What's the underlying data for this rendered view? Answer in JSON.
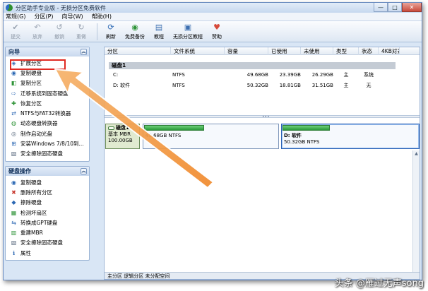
{
  "window": {
    "title": "分区助手专业版 - 无损分区免费软件",
    "controls": [
      "—",
      "□",
      "✕"
    ]
  },
  "menu": [
    "常规(G)",
    "分区(P)",
    "向导(W)",
    "帮助(H)"
  ],
  "toolbar": [
    {
      "label": "提交",
      "icon": "check-icon",
      "glyph": "✔",
      "enabled": false
    },
    {
      "label": "放弃",
      "icon": "discard-icon",
      "glyph": "↶",
      "enabled": false
    },
    {
      "label": "撤销",
      "icon": "undo-icon",
      "glyph": "↺",
      "enabled": false
    },
    {
      "label": "重做",
      "icon": "redo-icon",
      "glyph": "↻",
      "enabled": false
    },
    {
      "label": "刷新",
      "icon": "refresh-icon",
      "glyph": "⟳",
      "enabled": true
    },
    {
      "label": "免费备份",
      "icon": "backup-icon",
      "glyph": "◉",
      "enabled": true
    },
    {
      "label": "教程",
      "icon": "tutorial-icon",
      "glyph": "▤",
      "enabled": true
    },
    {
      "label": "无损分区教程",
      "icon": "partition-tutorial-icon",
      "glyph": "▣",
      "enabled": true
    },
    {
      "label": "赞助",
      "icon": "sponsor-icon",
      "glyph": "♥",
      "enabled": true
    }
  ],
  "sidebar": {
    "wizard": {
      "title": "向导",
      "items": [
        {
          "label": "扩展分区",
          "icon": "extend-partition-icon",
          "glyph": "◈"
        },
        {
          "label": "复制硬盘",
          "icon": "copy-disk-icon",
          "glyph": "◉"
        },
        {
          "label": "复制分区",
          "icon": "copy-partition-icon",
          "glyph": "◧"
        },
        {
          "label": "迁移系统到固态硬盘",
          "icon": "migrate-os-icon",
          "glyph": "⇨"
        },
        {
          "label": "恢复分区",
          "icon": "recover-partition-icon",
          "glyph": "✚"
        },
        {
          "label": "NTFS与FAT32转换器",
          "icon": "ntfs-fat32-icon",
          "glyph": "⇄"
        },
        {
          "label": "动态硬盘转换器",
          "icon": "dynamic-disk-icon",
          "glyph": "◍"
        },
        {
          "label": "制作启动光盘",
          "icon": "bootable-cd-icon",
          "glyph": "◎"
        },
        {
          "label": "安装Windows 7/8/10到...",
          "icon": "install-windows-icon",
          "glyph": "⊞"
        },
        {
          "label": "安全擦除固态硬盘",
          "icon": "secure-erase-ssd-icon",
          "glyph": "▧"
        }
      ]
    },
    "disk_ops": {
      "title": "硬盘操作",
      "items": [
        {
          "label": "复制硬盘",
          "icon": "copy-disk-icon",
          "glyph": "◉"
        },
        {
          "label": "删除所有分区",
          "icon": "delete-all-partitions-icon",
          "glyph": "✖"
        },
        {
          "label": "擦除硬盘",
          "icon": "wipe-disk-icon",
          "glyph": "◆"
        },
        {
          "label": "检测坏扇区",
          "icon": "bad-sector-icon",
          "glyph": "▦"
        },
        {
          "label": "转换成GPT硬盘",
          "icon": "convert-gpt-icon",
          "glyph": "⇆"
        },
        {
          "label": "重建MBR",
          "icon": "rebuild-mbr-icon",
          "glyph": "▥"
        },
        {
          "label": "安全擦除固态硬盘",
          "icon": "secure-erase-ssd-icon",
          "glyph": "▧"
        },
        {
          "label": "属性",
          "icon": "properties-icon",
          "glyph": "ℹ"
        }
      ]
    }
  },
  "table": {
    "columns": [
      "分区",
      "文件系统",
      "容量",
      "已使用",
      "未使用",
      "类型",
      "状态",
      "4KB对齐"
    ],
    "disk_label": "磁盘1",
    "rows": [
      {
        "name": "C:",
        "fs": "NTFS",
        "capacity": "49.68GB",
        "used": "23.39GB",
        "free": "26.29GB",
        "type": "主",
        "status": "系统"
      },
      {
        "name": "D: 软件",
        "fs": "NTFS",
        "capacity": "50.32GB",
        "used": "18.81GB",
        "free": "31.51GB",
        "type": "主",
        "status": "无"
      }
    ]
  },
  "diskmap": {
    "disk": {
      "name": "磁盘1",
      "kind": "基本 MBR",
      "size": "100.00GB"
    },
    "partitions": [
      {
        "label": "",
        "detail": "49.68GB NTFS"
      },
      {
        "label": "D: 软件",
        "detail": "50.32GB NTFS"
      }
    ]
  },
  "status": {
    "legend": "主分区  逻辑分区  未分配空间"
  },
  "watermark": "头条 @雁过无声song",
  "colors": {
    "highlight_box": "#e02a22",
    "arrow": "#f39a3a",
    "used_bar": "#2a9a39"
  }
}
